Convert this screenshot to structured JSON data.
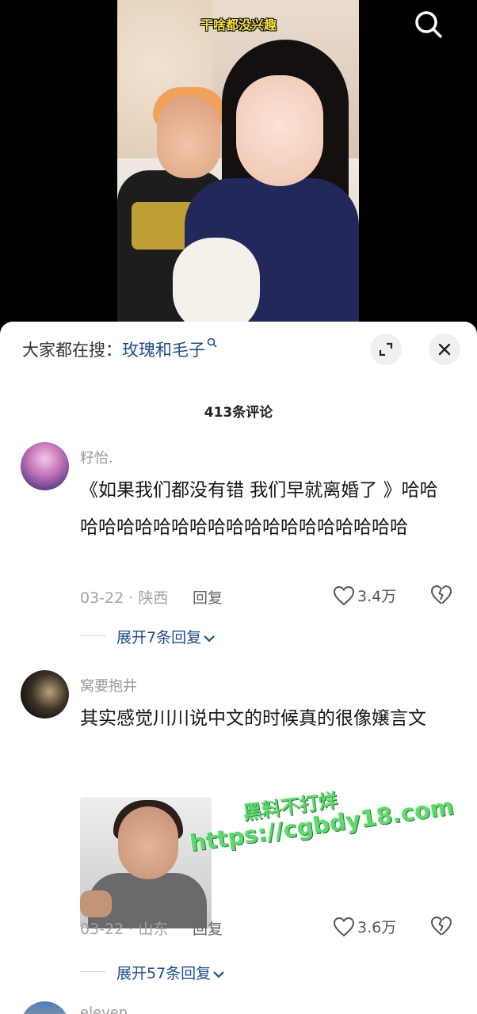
{
  "video": {
    "caption": "干啥都没兴趣",
    "search_icon": "search-icon"
  },
  "panel": {
    "hot_search_prefix": "大家都在搜：",
    "hot_search_keyword": "玫瑰和毛子",
    "expand_icon": "expand-icon",
    "close_icon": "close-icon",
    "comment_count": "413条评论"
  },
  "comments": [
    {
      "username": "籽怡.",
      "text": "《如果我们都没有错  我们早就离婚了 》哈哈哈哈哈哈哈哈哈哈哈哈哈哈哈哈哈哈哈哈",
      "meta": "03-22 · 陕西",
      "reply_label": "回复",
      "likes": "3.4万",
      "expand_label": "展开7条回复"
    },
    {
      "username": "窝要抱井",
      "text": "其实感觉川川说中文的时候真的很像嬢言文",
      "meta": "03-22 · 山东",
      "reply_label": "回复",
      "likes": "3.6万",
      "expand_label": "展开57条回复"
    }
  ],
  "next_comment_peek": {
    "username": "eleven"
  },
  "watermark": {
    "line1": "黑料不打烊",
    "line2": "https://cgbdy18.com"
  },
  "colors": {
    "link_blue": "#1f4e8c",
    "caption_yellow": "#f3e245",
    "watermark_green": "#58d667"
  }
}
